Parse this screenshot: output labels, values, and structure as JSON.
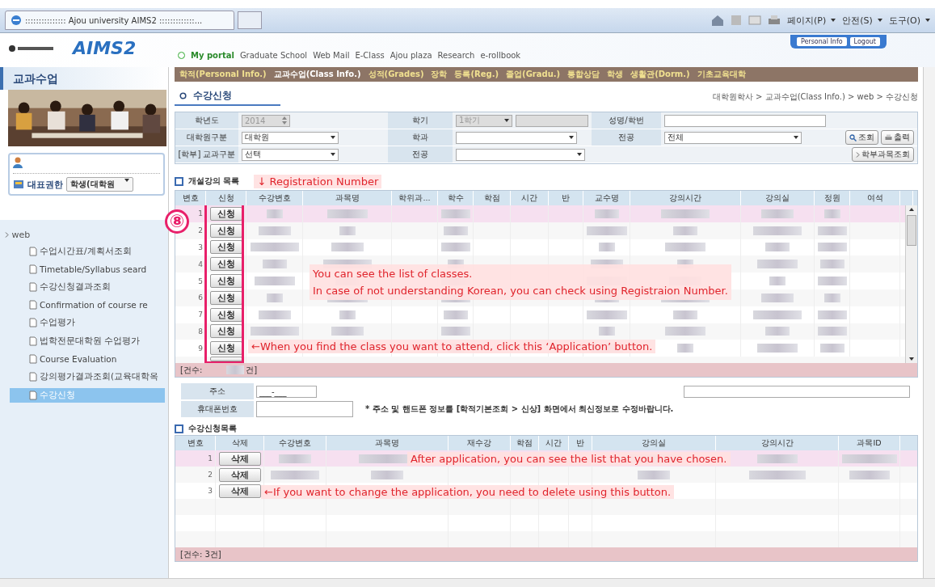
{
  "browser": {
    "tab_title": "::::::::::::::: Ajou university AIMS2 :::::::::::::...",
    "menus": [
      "페이지(P)",
      "안전(S)",
      "도구(O)"
    ]
  },
  "header": {
    "logo": "AIMS2",
    "account_buttons": [
      "Personal Info",
      "Logout"
    ],
    "links": [
      {
        "label": "My portal",
        "selected": true
      },
      {
        "label": "Graduate School",
        "selected": false
      },
      {
        "label": "Web Mail",
        "selected": false
      },
      {
        "label": "E-Class",
        "selected": false
      },
      {
        "label": "Ajou plaza",
        "selected": false
      },
      {
        "label": "Research",
        "selected": false
      },
      {
        "label": "e-rollbook",
        "selected": false
      }
    ],
    "menu": [
      {
        "label": "학적(Personal Info.)",
        "selected": false
      },
      {
        "label": "교과수업(Class Info.)",
        "selected": true
      },
      {
        "label": "성적(Grades)",
        "selected": false
      },
      {
        "label": "장학",
        "selected": false
      },
      {
        "label": "등록(Reg.)",
        "selected": false
      },
      {
        "label": "졸업(Gradu.)",
        "selected": false
      },
      {
        "label": "통합상담",
        "selected": false
      },
      {
        "label": "학생",
        "selected": false
      },
      {
        "label": "생활관(Dorm.)",
        "selected": false
      },
      {
        "label": "기초교육대학",
        "selected": false
      }
    ]
  },
  "sidebar": {
    "title": "교과수업",
    "role_label": "대표권한",
    "role_value": "학생(대학원",
    "tree": {
      "label": "web",
      "expanded": true,
      "children": [
        {
          "label": "수업시간표/계획서조회",
          "selected": false
        },
        {
          "label": "Timetable/Syllabus seard",
          "selected": false
        },
        {
          "label": "수강신청결과조회",
          "selected": false
        },
        {
          "label": "Confirmation of course re",
          "selected": false
        },
        {
          "label": "수업평가",
          "selected": false
        },
        {
          "label": "법학전문대학원 수업평가",
          "selected": false
        },
        {
          "label": "Course Evaluation",
          "selected": false
        },
        {
          "label": "강의평가결과조회(교육대학옥",
          "selected": false
        },
        {
          "label": "수강신청",
          "selected": true
        }
      ]
    }
  },
  "page": {
    "title": "수강신청",
    "breadcrumb": "대학원학사 > 교과수업(Class Info.) > web > 수강신청"
  },
  "form": {
    "year_label": "학년도",
    "year": "2014",
    "term_label": "학기",
    "term": "1학기",
    "name_label": "성명/학번",
    "grad_type_label": "대학원구분",
    "grad_type": "대학원",
    "dept_label": "학과",
    "major_label": "전공",
    "major": "전체",
    "undergrad_label": "[학부] 교과구분",
    "undergrad": "선택",
    "major2_label": "전공",
    "buttons": [
      "조회",
      "출력"
    ],
    "undergrad_button": "학부과목조회"
  },
  "courses": {
    "title": "개설강의 목록",
    "columns": [
      "변호",
      "신청",
      "수강변호",
      "과목명",
      "학위과...",
      "학수",
      "학점",
      "시간",
      "반",
      "교수명",
      "강의시간",
      "강의실",
      "정원",
      "여석"
    ],
    "rows": [
      {
        "number": "1",
        "button": "신청",
        "selected": true
      },
      {
        "number": "2",
        "button": "신청",
        "selected": false
      },
      {
        "number": "3",
        "button": "신청",
        "selected": false
      },
      {
        "number": "4",
        "button": "신청",
        "selected": false
      },
      {
        "number": "5",
        "button": "신청",
        "selected": false
      },
      {
        "number": "6",
        "button": "신청",
        "selected": false
      },
      {
        "number": "7",
        "button": "신청",
        "selected": false
      },
      {
        "number": "8",
        "button": "신청",
        "selected": false
      },
      {
        "number": "9",
        "button": "신청",
        "selected": false
      }
    ],
    "count_prefix": "[건수:",
    "count_suffix": "건]"
  },
  "contact": {
    "address_label": "주소",
    "postal": "___-___",
    "phone_label": "휴대폰번호",
    "notice": "* 주소 및 핸드폰 정보를 [학적기본조회 > 신상] 화면에서 최신정보로 수정바랍니다."
  },
  "applied": {
    "title": "수강신청목록",
    "columns": [
      "변호",
      "삭제",
      "수강변호",
      "과목명",
      "재수강",
      "학점",
      "시간",
      "반",
      "강의실",
      "강의시간",
      "과목ID"
    ],
    "rows": [
      {
        "number": "1",
        "button": "삭제",
        "selected": true
      },
      {
        "number": "2",
        "button": "삭제",
        "selected": false
      },
      {
        "number": "3",
        "button": "삭제",
        "selected": false
      }
    ],
    "count": "[건수:   3건]"
  },
  "annotations": {
    "step": "⑧",
    "registration": "↓ Registration Number",
    "list_note": [
      "You can see the list of classes.",
      "In case of not understanding Korean, you can check using Registraion Number."
    ],
    "apply_note": "←When you find the class you want to attend, click this ‘Application’ button.",
    "chosen_note": "After application, you can see the list that you have chosen.",
    "delete_note": "←If you want to change the application, you need to delete using this button."
  }
}
